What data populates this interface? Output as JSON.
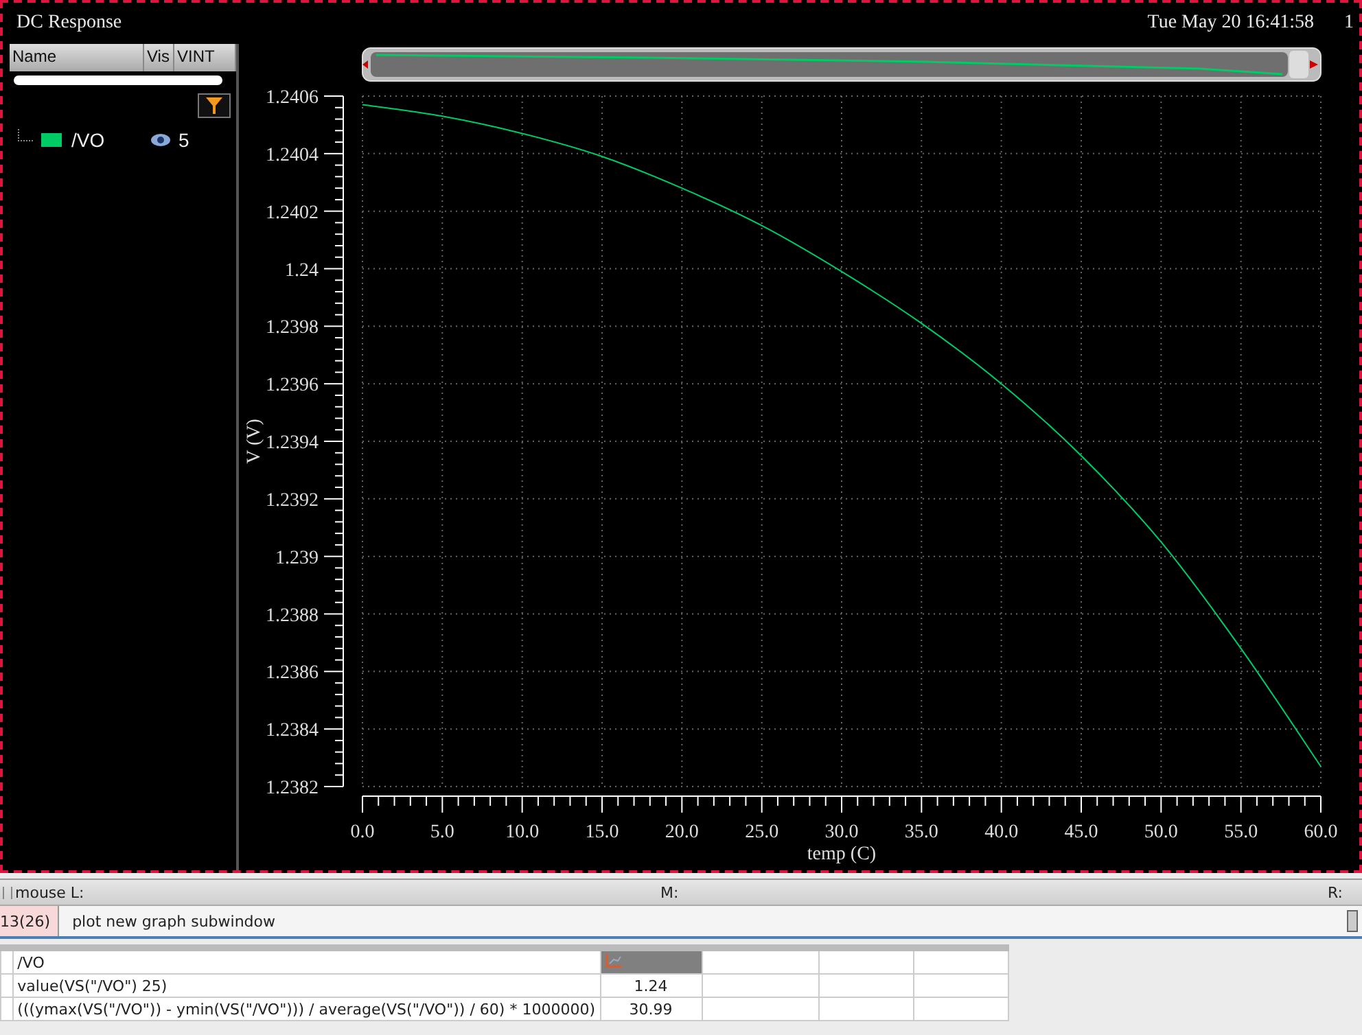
{
  "window": {
    "title": "DC Response",
    "timestamp": "Tue May 20 16:41:58",
    "corner_text": "1"
  },
  "signal_panel": {
    "columns": [
      "Name",
      "Vis",
      "VINT"
    ],
    "signals": [
      {
        "name": "/VO",
        "color": "#00cc66",
        "visible": true,
        "vint": "5"
      }
    ]
  },
  "graph": {
    "chart_data": {
      "type": "line",
      "xlabel": "temp (C)",
      "ylabel": "V (V)",
      "xlim": [
        0,
        60
      ],
      "ylim": [
        1.2382,
        1.2406
      ],
      "xticks": [
        {
          "value": 0,
          "label": "0.0"
        },
        {
          "value": 5,
          "label": "5.0"
        },
        {
          "value": 10,
          "label": "10.0"
        },
        {
          "value": 15,
          "label": "15.0"
        },
        {
          "value": 20,
          "label": "20.0"
        },
        {
          "value": 25,
          "label": "25.0"
        },
        {
          "value": 30,
          "label": "30.0"
        },
        {
          "value": 35,
          "label": "35.0"
        },
        {
          "value": 40,
          "label": "40.0"
        },
        {
          "value": 45,
          "label": "45.0"
        },
        {
          "value": 50,
          "label": "50.0"
        },
        {
          "value": 55,
          "label": "55.0"
        },
        {
          "value": 60,
          "label": "60.0"
        }
      ],
      "yticks": [
        {
          "value": 1.2382,
          "label": "1.2382"
        },
        {
          "value": 1.2384,
          "label": "1.2384"
        },
        {
          "value": 1.2386,
          "label": "1.2386"
        },
        {
          "value": 1.2388,
          "label": "1.2388"
        },
        {
          "value": 1.239,
          "label": "1.239"
        },
        {
          "value": 1.2392,
          "label": "1.2392"
        },
        {
          "value": 1.2394,
          "label": "1.2394"
        },
        {
          "value": 1.2396,
          "label": "1.2396"
        },
        {
          "value": 1.2398,
          "label": "1.2398"
        },
        {
          "value": 1.24,
          "label": "1.24"
        },
        {
          "value": 1.2402,
          "label": "1.2402"
        },
        {
          "value": 1.2404,
          "label": "1.2404"
        },
        {
          "value": 1.2406,
          "label": "1.2406"
        }
      ],
      "x": [
        0,
        5,
        10,
        15,
        20,
        25,
        30,
        35,
        40,
        45,
        50,
        55,
        60
      ],
      "grid": true,
      "series": [
        {
          "color": "#00cc66",
          "values": [
            1.24057,
            1.24053,
            1.24047,
            1.24039,
            1.24028,
            1.24015,
            1.23999,
            1.23981,
            1.2396,
            1.23935,
            1.23905,
            1.23868,
            1.23827
          ]
        }
      ]
    }
  },
  "status_bar": {
    "mouse_l": "mouse L:",
    "mouse_m": "M:",
    "mouse_r": "R:"
  },
  "command_line": {
    "number": "13(26)",
    "text": "plot new graph subwindow"
  },
  "results": {
    "header": {
      "expression": "/VO"
    },
    "rows": [
      {
        "expression": "value(VS(\"/VO\") 25)",
        "value": "1.24"
      },
      {
        "expression": "(((ymax(VS(\"/VO\")) - ymin(VS(\"/VO\"))) / average(VS(\"/VO\")) / 60) * 1000000)",
        "value": "30.99"
      }
    ]
  }
}
